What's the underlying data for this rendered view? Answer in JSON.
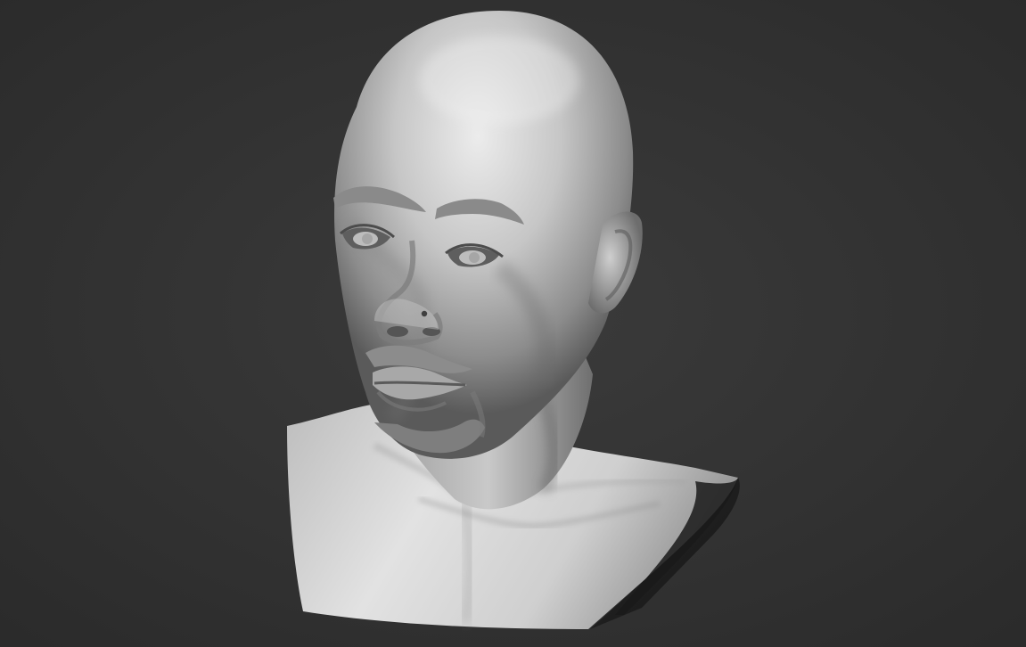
{
  "scene": {
    "subject": "bust-sculpt",
    "colors": {
      "background_center": "#3a3a3a",
      "background_edge": "#2a2a2a",
      "clay_light": "#e6e6e6",
      "clay_mid": "#b9b9b9",
      "clay_dark": "#6f6f6f",
      "clay_shadow": "#3c3c3c",
      "base_cut": "#1c1c1c"
    }
  }
}
